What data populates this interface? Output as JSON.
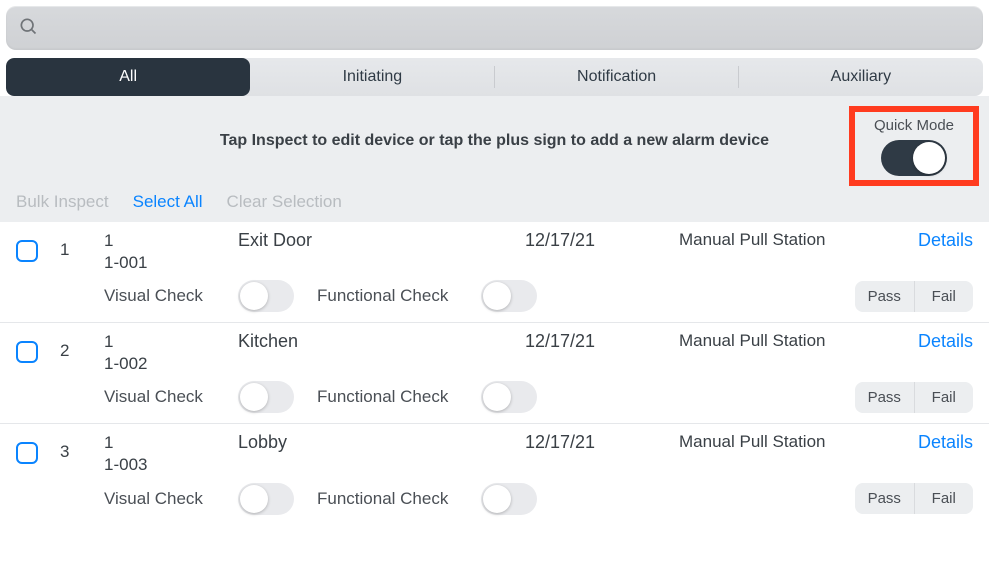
{
  "search": {
    "placeholder": ""
  },
  "tabs": [
    {
      "label": "All",
      "active": true
    },
    {
      "label": "Initiating",
      "active": false
    },
    {
      "label": "Notification",
      "active": false
    },
    {
      "label": "Auxiliary",
      "active": false
    }
  ],
  "instruction": "Tap Inspect to edit device or tap the plus sign to add a new alarm device",
  "quick_mode": {
    "label": "Quick Mode",
    "on": true
  },
  "bulk": {
    "bulk_inspect": "Bulk Inspect",
    "select_all": "Select All",
    "clear_selection": "Clear Selection"
  },
  "labels": {
    "visual_check": "Visual Check",
    "functional_check": "Functional Check",
    "pass": "Pass",
    "fail": "Fail",
    "details": "Details"
  },
  "rows": [
    {
      "index": "1",
      "group": "1",
      "id": "1-001",
      "location": "Exit Door",
      "date": "12/17/21",
      "type": "Manual Pull Station"
    },
    {
      "index": "2",
      "group": "1",
      "id": "1-002",
      "location": "Kitchen",
      "date": "12/17/21",
      "type": "Manual Pull Station"
    },
    {
      "index": "3",
      "group": "1",
      "id": "1-003",
      "location": "Lobby",
      "date": "12/17/21",
      "type": "Manual Pull Station"
    }
  ]
}
